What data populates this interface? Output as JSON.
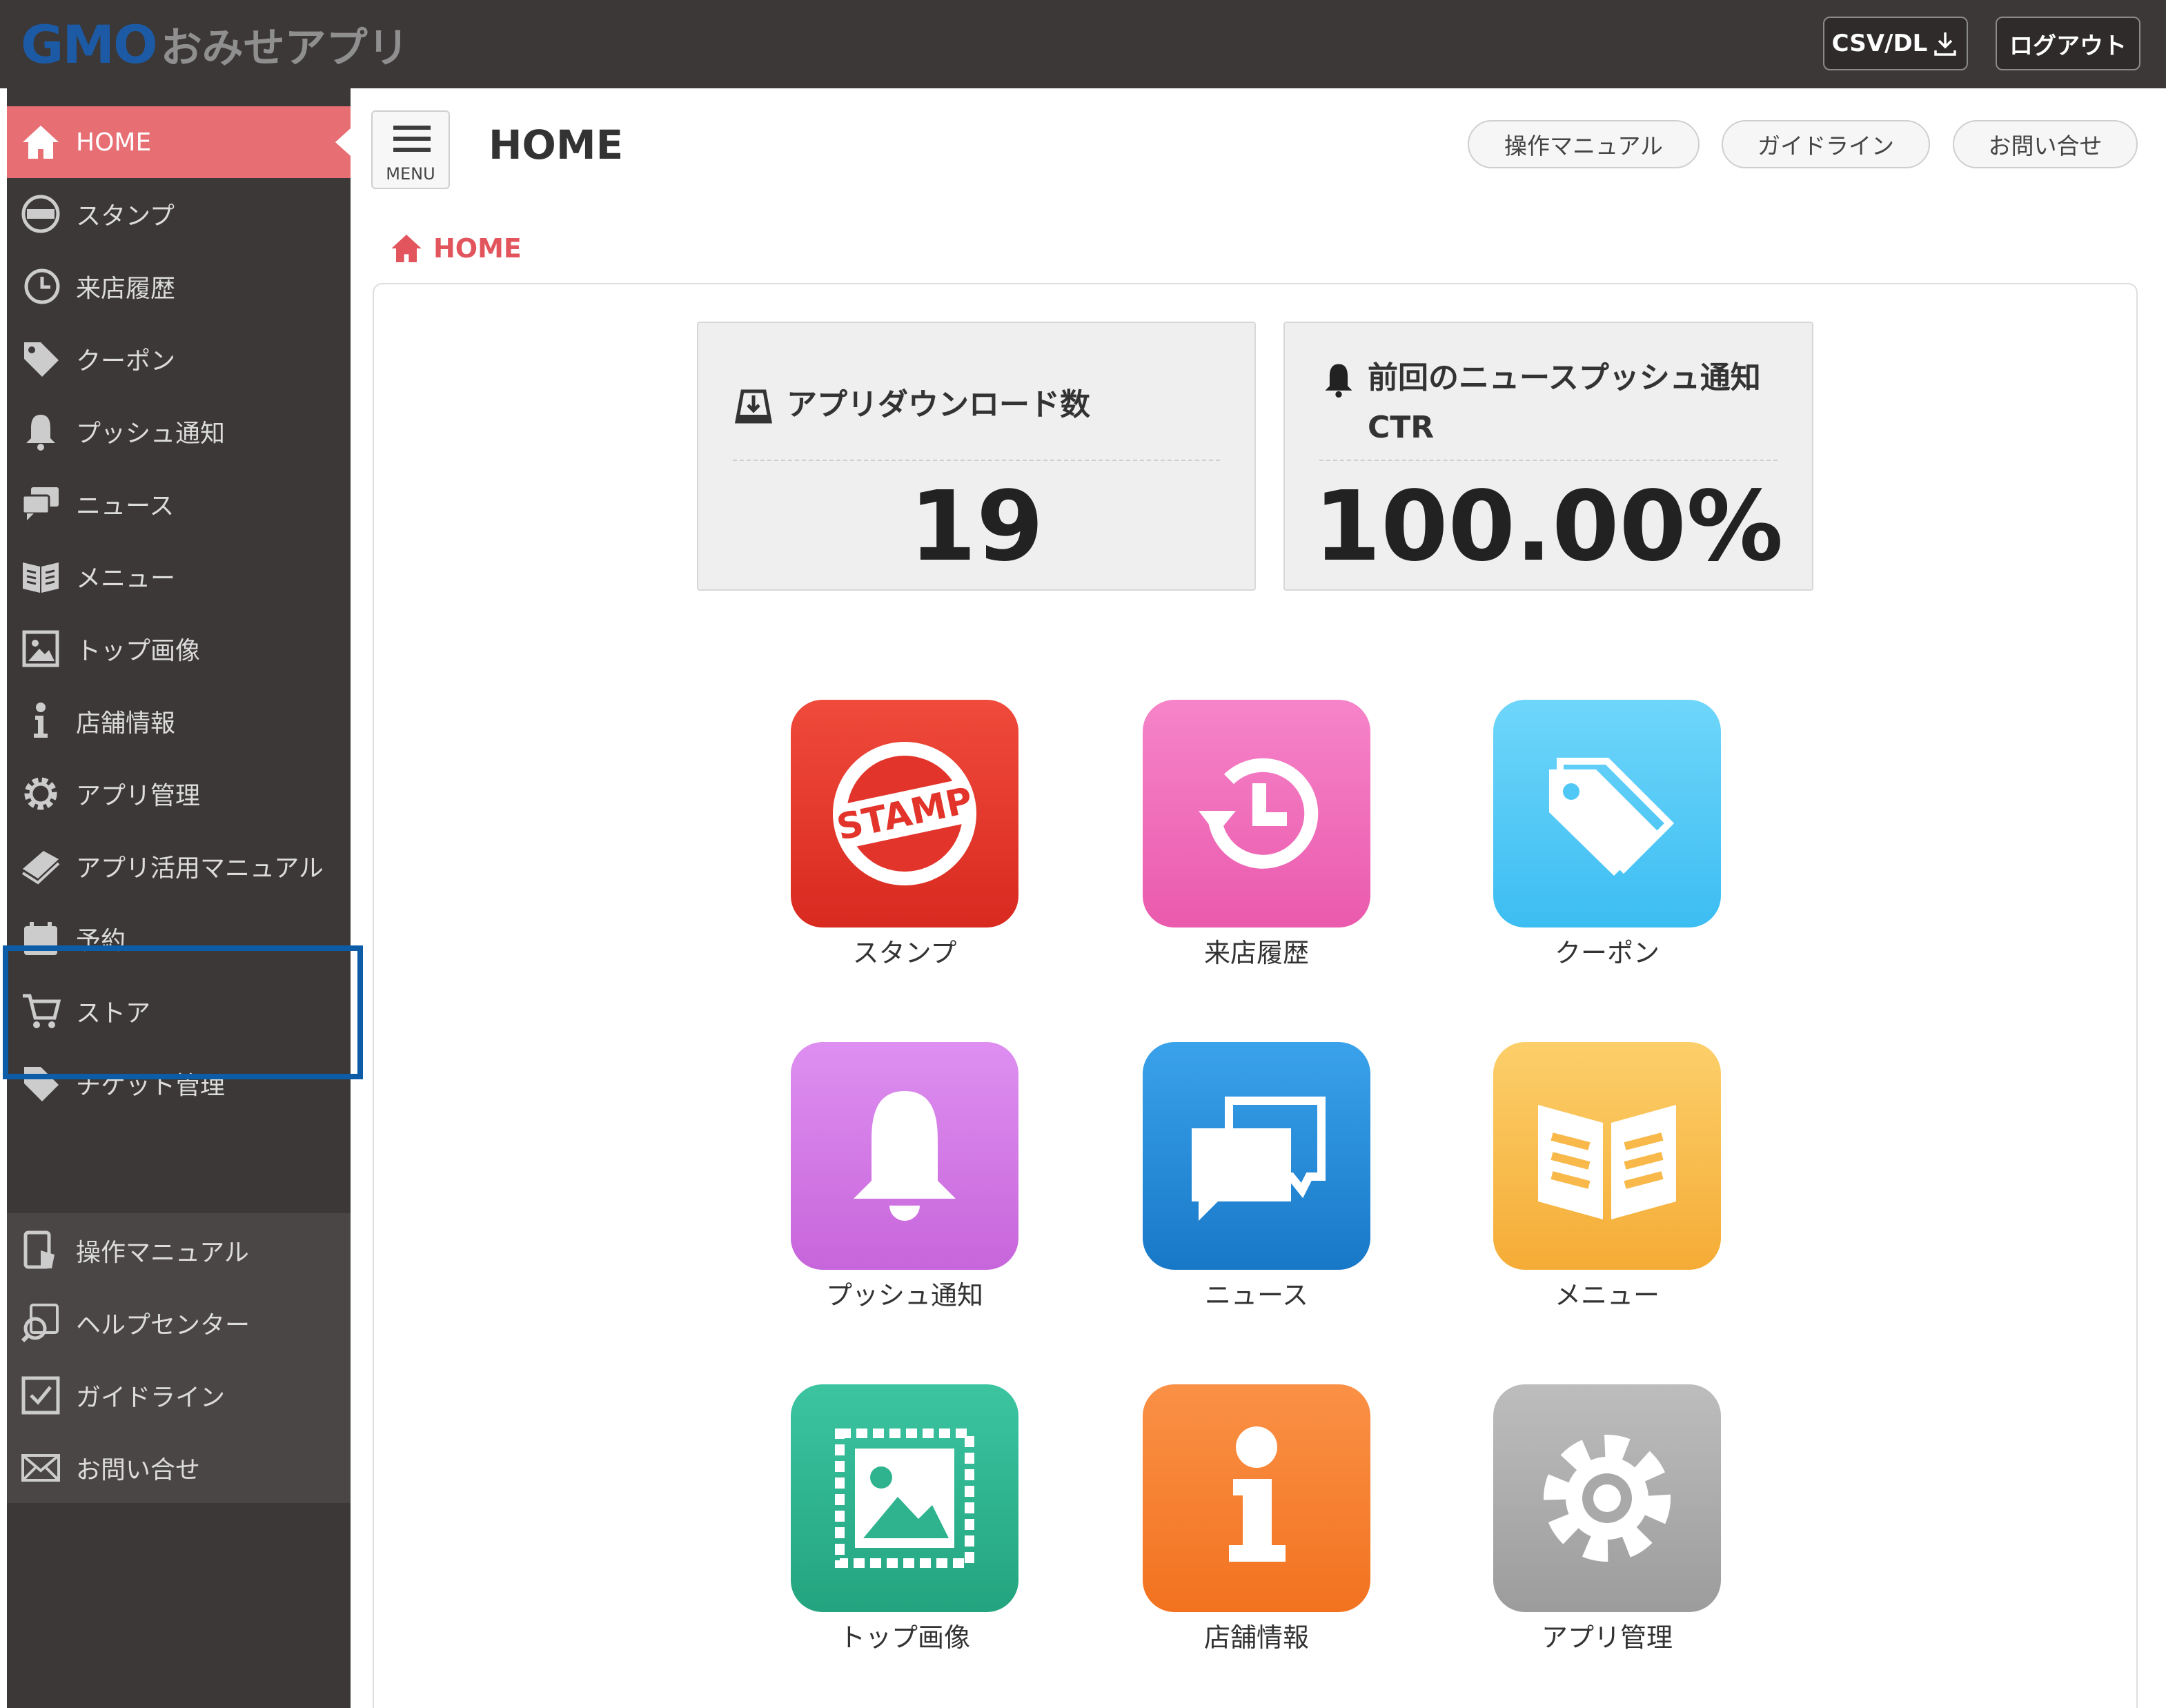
{
  "topbar": {
    "logo_brand": "GMO",
    "logo_name": "おみせアプリ",
    "csv_label": "CSV/DL",
    "logout_label": "ログアウト"
  },
  "sidebar": {
    "items": [
      {
        "label": "HOME",
        "icon": "home-icon"
      },
      {
        "label": "スタンプ",
        "icon": "stamp-icon"
      },
      {
        "label": "来店履歴",
        "icon": "history-icon"
      },
      {
        "label": "クーポン",
        "icon": "tag-icon"
      },
      {
        "label": "プッシュ通知",
        "icon": "bell-icon"
      },
      {
        "label": "ニュース",
        "icon": "chat-icon"
      },
      {
        "label": "メニュー",
        "icon": "book-icon"
      },
      {
        "label": "トップ画像",
        "icon": "image-icon"
      },
      {
        "label": "店舗情報",
        "icon": "info-icon"
      },
      {
        "label": "アプリ管理",
        "icon": "gear-icon"
      },
      {
        "label": "アプリ活用マニュアル",
        "icon": "manual-icon"
      },
      {
        "label": "予約",
        "icon": "calendar-icon"
      },
      {
        "label": "ストア",
        "icon": "cart-icon"
      },
      {
        "label": "チケット管理",
        "icon": "ticket-icon"
      }
    ],
    "support_items": [
      {
        "label": "操作マニュアル",
        "icon": "manual-hand-icon"
      },
      {
        "label": "ヘルプセンター",
        "icon": "help-icon"
      },
      {
        "label": "ガイドライン",
        "icon": "checkbox-icon"
      },
      {
        "label": "お問い合せ",
        "icon": "mail-icon"
      }
    ]
  },
  "header": {
    "menu_label": "MENU",
    "title": "HOME",
    "links": [
      "操作マニュアル",
      "ガイドライン",
      "お問い合せ"
    ]
  },
  "breadcrumb": {
    "label": "HOME"
  },
  "stats": [
    {
      "title": "アプリダウンロード数",
      "value": "19"
    },
    {
      "title": "前回のニュースプッシュ通知CTR",
      "value": "100.00%"
    }
  ],
  "tiles": [
    {
      "label": "スタンプ",
      "icon": "stamp-icon",
      "color": "#e2342b",
      "stamp_text": "STAMP"
    },
    {
      "label": "来店履歴",
      "icon": "history-icon",
      "color": "#ef6cb9"
    },
    {
      "label": "クーポン",
      "icon": "tag-icon",
      "color": "#4fc8f5"
    },
    {
      "label": "プッシュ通知",
      "icon": "bell-icon",
      "color": "#cf75e4"
    },
    {
      "label": "ニュース",
      "icon": "chat-icon",
      "color": "#2389d6"
    },
    {
      "label": "メニュー",
      "icon": "book-icon",
      "color": "#f8b94a"
    },
    {
      "label": "トップ画像",
      "icon": "image-icon",
      "color": "#2fb38f"
    },
    {
      "label": "店舗情報",
      "icon": "info-icon",
      "color": "#f47d2b"
    },
    {
      "label": "アプリ管理",
      "icon": "gear-icon",
      "color": "#a9a9a9"
    }
  ],
  "colors": {
    "topbar": "#3c3837",
    "sidebar": "#3c3837",
    "active": "#e76f74",
    "breadcrumb": "#e2555d",
    "highlight": "#0c5ca8"
  }
}
